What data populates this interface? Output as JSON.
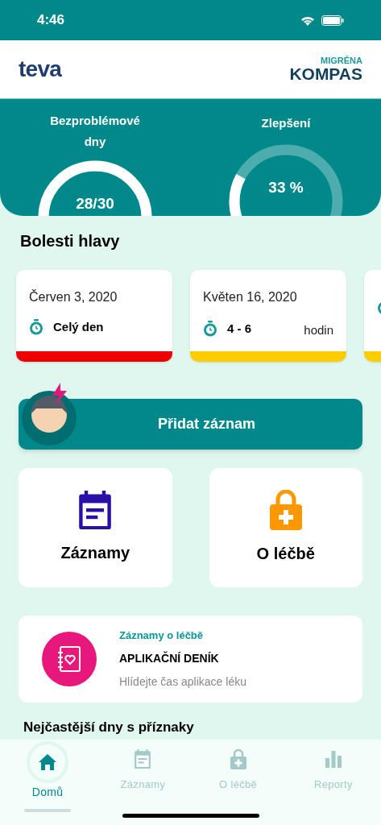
{
  "status_bar": {
    "time": "4:46"
  },
  "header": {
    "left_logo": "teva",
    "right_logo_top": "MIGRÉNA",
    "right_logo_bottom": "KOMPAS"
  },
  "stats": [
    {
      "label": "Bezproblémové dny",
      "value": "28/30"
    },
    {
      "label": "Zlepšení",
      "value": "33 %"
    }
  ],
  "headaches": {
    "title": "Bolesti hlavy",
    "cards": [
      {
        "date": "Červen 3, 2020",
        "duration": "Celý den",
        "color": "#ee0000"
      },
      {
        "date": "Květen 16, 2020",
        "duration": "4 - 6",
        "unit": "hodin",
        "color": "#ffcc00"
      },
      {
        "color": "#ffcc00"
      }
    ]
  },
  "add_button": "Přidat záznam",
  "tiles": [
    {
      "kind": "calendar",
      "label": "Záznamy"
    },
    {
      "kind": "lock",
      "label": "O léčbě"
    }
  ],
  "diary": {
    "category": "Záznamy o léčbě",
    "title": "APLIKAČNÍ DENÍK",
    "subtitle": "Hlídejte čas aplikace léku"
  },
  "next_heading": "Nejčastější dny s příznaky",
  "nav": [
    {
      "kind": "home",
      "label": "Domů",
      "selected": true
    },
    {
      "kind": "calendar",
      "label": "Záznamy",
      "selected": false
    },
    {
      "kind": "lock",
      "label": "O léčbě",
      "selected": false
    },
    {
      "kind": "chart",
      "label": "Reporty",
      "selected": false
    }
  ]
}
